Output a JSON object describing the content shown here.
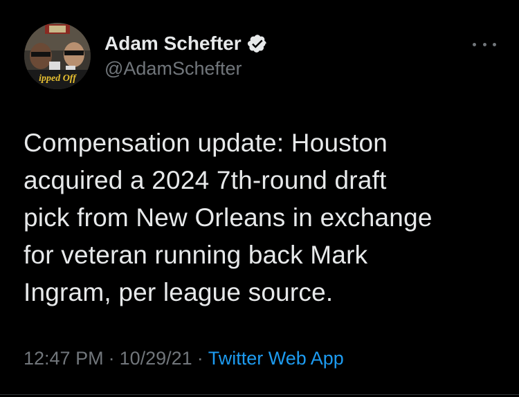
{
  "user": {
    "display_name": "Adam Schefter",
    "handle": "@AdamSchefter",
    "verified_icon": "verified-badge-icon",
    "avatar_caption": "ipped Off"
  },
  "tweet": {
    "lines": [
      "Compensation update: Houston",
      "acquired a 2024 7th-round draft",
      "pick from New Orleans in exchange",
      "for veteran running back Mark",
      "Ingram, per league source."
    ]
  },
  "meta": {
    "time": "12:47 PM",
    "separator": "·",
    "date": "10/29/21",
    "source": "Twitter Web App"
  },
  "colors": {
    "background": "#000000",
    "text": "#e7e9ea",
    "muted": "#71767b",
    "link": "#1d9bf0",
    "verified": "#e7e9ea"
  },
  "icons": {
    "more": "more-horizontal-icon"
  }
}
